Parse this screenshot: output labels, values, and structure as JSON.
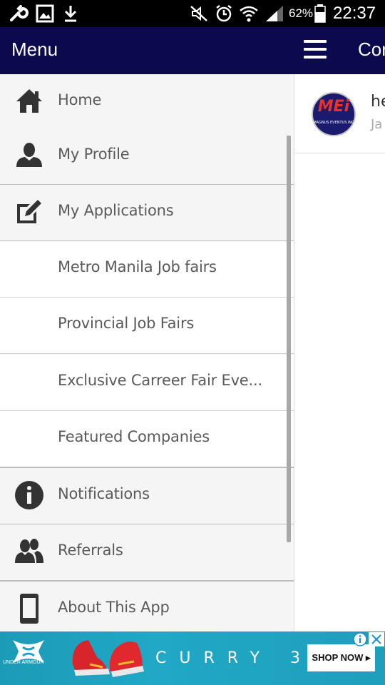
{
  "status_bar": {
    "battery": "62%",
    "time": "22:37"
  },
  "drawer": {
    "title": "Menu",
    "items": [
      {
        "label": "Home",
        "icon": "home-icon"
      },
      {
        "label": "My Profile",
        "icon": "person-icon"
      },
      {
        "label": "My Applications",
        "icon": "edit-icon"
      },
      {
        "label": "Metro Manila Job fairs"
      },
      {
        "label": "Provincial Job Fairs"
      },
      {
        "label": "Exclusive Carreer Fair Eve..."
      },
      {
        "label": "Featured Companies"
      },
      {
        "label": "Notifications",
        "icon": "info-icon"
      },
      {
        "label": "Referrals",
        "icon": "people-icon"
      },
      {
        "label": "About This App",
        "icon": "phone-icon"
      }
    ]
  },
  "main": {
    "title": "Cor",
    "card": {
      "title": "he",
      "subtitle": "Ja",
      "logo_text": "MEi",
      "logo_subtext": "MAGNUS EVENTUS INC"
    }
  },
  "ad": {
    "brand": "UNDER ARMOUR",
    "product": "CURRY 3",
    "cta": "SHOP NOW ▸"
  },
  "colors": {
    "header": "#0c0a4f",
    "ad_background": "#1ea3c0"
  }
}
